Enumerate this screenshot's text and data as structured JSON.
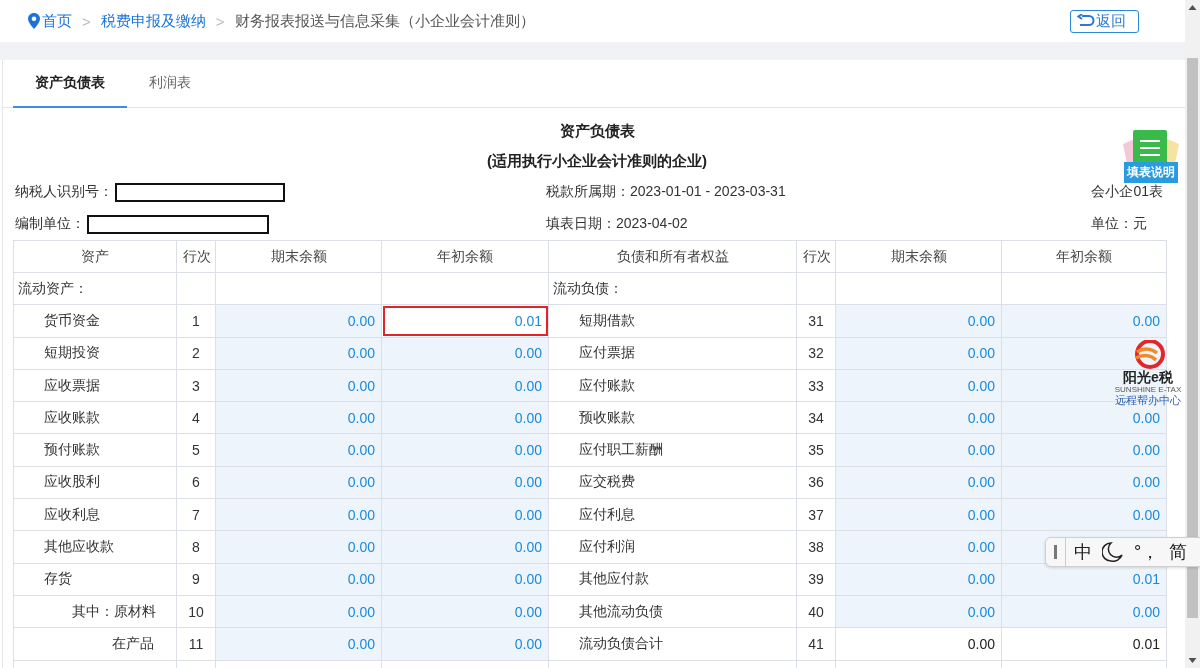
{
  "breadcrumb": [
    {
      "label": "首页",
      "kind": "home"
    },
    {
      "sep": ">",
      "label": "税费申报及缴纳",
      "kind": "link"
    },
    {
      "sep": ">",
      "label": "财务报表报送与信息采集（小企业会计准则）",
      "kind": "current"
    }
  ],
  "back_button": {
    "label": "返回"
  },
  "tabs": [
    {
      "label": "资产负债表",
      "selected": true
    },
    {
      "label": "利润表",
      "selected": false
    }
  ],
  "sheet": {
    "title": "资产负债表",
    "subtitle": "(适用执行小企业会计准则的企业)",
    "taxpayer_id_label": "纳税人识别号：",
    "period": "税款所属期：2023-01-01 - 2023-03-31",
    "form_code": "会小企01表",
    "preparer_label": "编制单位：",
    "fill_date": "填表日期：2023-04-02",
    "unit": "单位：元",
    "columns": [
      "资产",
      "行次",
      "期末余额",
      "年初余额",
      "负债和所有者权益",
      "行次",
      "期末余额",
      "年初余额"
    ],
    "rows": [
      {
        "asset": {
          "label": "流动资产：",
          "kind": "section"
        },
        "liability": {
          "label": "流动负债：",
          "kind": "section"
        }
      },
      {
        "asset": {
          "label": "货币资金",
          "kind": "item"
        },
        "line": "1",
        "end": {
          "value": "0.00",
          "kind": "input",
          "flagged": false
        },
        "begin": {
          "value": "0.01",
          "kind": "input",
          "flagged": true
        },
        "liability": {
          "label": "短期借款",
          "kind": "item"
        },
        "line2": "31",
        "end2": {
          "value": "0.00",
          "kind": "input",
          "flagged": false
        },
        "begin2": {
          "value": "0.00",
          "kind": "input",
          "flagged": false
        }
      },
      {
        "asset": {
          "label": "短期投资",
          "kind": "item"
        },
        "line": "2",
        "end": {
          "value": "0.00",
          "kind": "input",
          "flagged": false
        },
        "begin": {
          "value": "0.00",
          "kind": "input",
          "flagged": false
        },
        "liability": {
          "label": "应付票据",
          "kind": "item"
        },
        "line2": "32",
        "end2": {
          "value": "0.00",
          "kind": "input",
          "flagged": false
        },
        "begin2": {
          "kind": "input",
          "flagged": false
        }
      },
      {
        "asset": {
          "label": "应收票据",
          "kind": "item"
        },
        "line": "3",
        "end": {
          "value": "0.00",
          "kind": "input",
          "flagged": false
        },
        "begin": {
          "value": "0.00",
          "kind": "input",
          "flagged": false
        },
        "liability": {
          "label": "应付账款",
          "kind": "item"
        },
        "line2": "33",
        "end2": {
          "value": "0.00",
          "kind": "input",
          "flagged": false
        },
        "begin2": {
          "kind": "input",
          "flagged": false
        }
      },
      {
        "asset": {
          "label": "应收账款",
          "kind": "item"
        },
        "line": "4",
        "end": {
          "value": "0.00",
          "kind": "input",
          "flagged": false
        },
        "begin": {
          "value": "0.00",
          "kind": "input",
          "flagged": false
        },
        "liability": {
          "label": "预收账款",
          "kind": "item"
        },
        "line2": "34",
        "end2": {
          "value": "0.00",
          "kind": "input",
          "flagged": false
        },
        "begin2": {
          "value": "0.00",
          "kind": "input",
          "flagged": false
        }
      },
      {
        "asset": {
          "label": "预付账款",
          "kind": "item"
        },
        "line": "5",
        "end": {
          "value": "0.00",
          "kind": "input",
          "flagged": false
        },
        "begin": {
          "value": "0.00",
          "kind": "input",
          "flagged": false
        },
        "liability": {
          "label": "应付职工薪酬",
          "kind": "item"
        },
        "line2": "35",
        "end2": {
          "value": "0.00",
          "kind": "input",
          "flagged": false
        },
        "begin2": {
          "value": "0.00",
          "kind": "input",
          "flagged": false
        }
      },
      {
        "asset": {
          "label": "应收股利",
          "kind": "item"
        },
        "line": "6",
        "end": {
          "value": "0.00",
          "kind": "input",
          "flagged": false
        },
        "begin": {
          "value": "0.00",
          "kind": "input",
          "flagged": false
        },
        "liability": {
          "label": "应交税费",
          "kind": "item"
        },
        "line2": "36",
        "end2": {
          "value": "0.00",
          "kind": "input",
          "flagged": false
        },
        "begin2": {
          "value": "0.00",
          "kind": "input",
          "flagged": false
        }
      },
      {
        "asset": {
          "label": "应收利息",
          "kind": "item"
        },
        "line": "7",
        "end": {
          "value": "0.00",
          "kind": "input",
          "flagged": false
        },
        "begin": {
          "value": "0.00",
          "kind": "input",
          "flagged": false
        },
        "liability": {
          "label": "应付利息",
          "kind": "item"
        },
        "line2": "37",
        "end2": {
          "value": "0.00",
          "kind": "input",
          "flagged": false
        },
        "begin2": {
          "value": "0.00",
          "kind": "input",
          "flagged": false
        }
      },
      {
        "asset": {
          "label": "其他应收款",
          "kind": "item"
        },
        "line": "8",
        "end": {
          "value": "0.00",
          "kind": "input",
          "flagged": false
        },
        "begin": {
          "value": "0.00",
          "kind": "input",
          "flagged": false
        },
        "liability": {
          "label": "应付利润",
          "kind": "item"
        },
        "line2": "38",
        "end2": {
          "value": "0.00",
          "kind": "input",
          "flagged": false
        },
        "begin2": {
          "kind": "input",
          "flagged": false
        }
      },
      {
        "asset": {
          "label": "存货",
          "kind": "item"
        },
        "line": "9",
        "end": {
          "value": "0.00",
          "kind": "input",
          "flagged": false
        },
        "begin": {
          "value": "0.00",
          "kind": "input",
          "flagged": false
        },
        "liability": {
          "label": "其他应付款",
          "kind": "item"
        },
        "line2": "39",
        "end2": {
          "value": "0.00",
          "kind": "input",
          "flagged": false
        },
        "begin2": {
          "value": "0.01",
          "kind": "input",
          "flagged": false
        }
      },
      {
        "asset": {
          "label": "其中：原材料",
          "kind": "sub"
        },
        "line": "10",
        "end": {
          "value": "0.00",
          "kind": "input",
          "flagged": false
        },
        "begin": {
          "value": "0.00",
          "kind": "input",
          "flagged": false
        },
        "liability": {
          "label": "其他流动负债",
          "kind": "item"
        },
        "line2": "40",
        "end2": {
          "value": "0.00",
          "kind": "input",
          "flagged": false
        },
        "begin2": {
          "value": "0.00",
          "kind": "input",
          "flagged": false
        }
      },
      {
        "asset": {
          "label": "在产品",
          "kind": "sub2"
        },
        "line": "11",
        "end": {
          "value": "0.00",
          "kind": "input",
          "flagged": false
        },
        "begin": {
          "value": "0.00",
          "kind": "input",
          "flagged": false
        },
        "liability": {
          "label": "流动负债合计",
          "kind": "item"
        },
        "line2": "41",
        "end2": {
          "value": "0.00",
          "kind": "calc",
          "flagged": false
        },
        "begin2": {
          "value": "0.01",
          "kind": "calc",
          "flagged": false
        }
      }
    ]
  },
  "help_widget": {
    "label": "填表说明"
  },
  "remote_help": {
    "brand": "阳光e税",
    "brand_en": "SUNSHINE E-TAX",
    "label": "远程帮办中心"
  },
  "ime_toolbar": {
    "mode": "中",
    "punct": "°，",
    "script": "简"
  }
}
